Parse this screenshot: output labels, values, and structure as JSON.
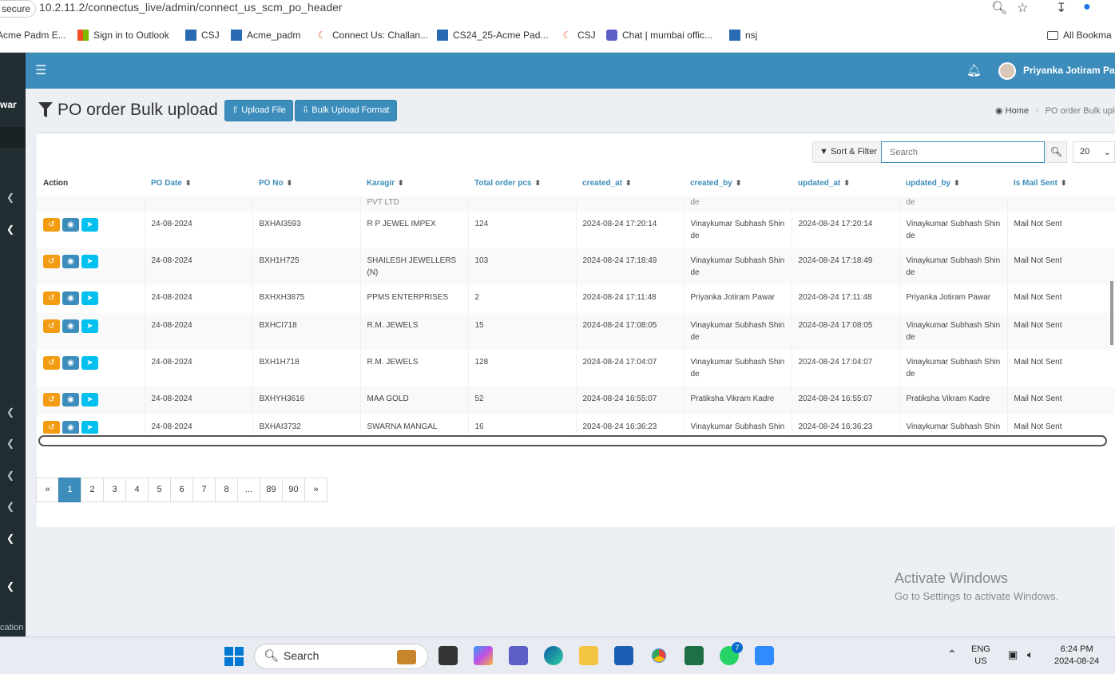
{
  "browser": {
    "secure_label": "secure",
    "url": "10.2.11.2/connectus_live/admin/connect_us_scm_po_header"
  },
  "bookmarks": [
    {
      "label": "Acme Padm E...",
      "icon": "favicon-icon"
    },
    {
      "label": "Sign in to Outlook",
      "icon": "microsoft-icon"
    },
    {
      "label": "CSJ",
      "icon": "app-icon"
    },
    {
      "label": "Acme_padm",
      "icon": "app-icon"
    },
    {
      "label": "Connect Us: Challan...",
      "icon": "connectus-icon"
    },
    {
      "label": "CS24_25-Acme Pad...",
      "icon": "app-icon"
    },
    {
      "label": "CSJ",
      "icon": "connectus-icon"
    },
    {
      "label": "Chat | mumbai offic...",
      "icon": "teams-icon"
    },
    {
      "label": "nsj",
      "icon": "app-icon"
    },
    {
      "label": "All Bookma",
      "icon": "folder-icon"
    }
  ],
  "sidebar": {
    "user_fragment": "war",
    "bottom_fragment": "cation"
  },
  "topnav": {
    "user_name": "Priyanka Jotiram Paw"
  },
  "page": {
    "title": "PO order Bulk upload",
    "upload_button": "Upload File",
    "format_button": "Bulk Upload Format",
    "breadcrumb_home": "Home",
    "breadcrumb_sep": ">",
    "breadcrumb_current": "PO order Bulk uploa"
  },
  "tools": {
    "sort_filter": "Sort & Filter",
    "search_placeholder": "Search",
    "page_size": "20"
  },
  "table": {
    "headers": [
      "Action",
      "PO Date",
      "PO No",
      "Karagir",
      "Total order pcs",
      "created_at",
      "created_by",
      "updated_at",
      "updated_by",
      "Is Mail Sent"
    ],
    "partial_row": {
      "karagir": "PVT LTD",
      "created_by": "de",
      "updated_by": "de"
    },
    "rows": [
      {
        "po_date": "24-08-2024",
        "po_no": "BXHAI3593",
        "karagir": "R P JEWEL IMPEX",
        "pcs": "124",
        "created_at": "2024-08-24 17:20:14",
        "created_by": "Vinaykumar Subhash Shin de",
        "updated_at": "2024-08-24 17:20:14",
        "updated_by": "Vinaykumar Subhash Shin de",
        "mail": "Mail Not Sent"
      },
      {
        "po_date": "24-08-2024",
        "po_no": "BXH1H725",
        "karagir": "SHAILESH JEWELLERS (N)",
        "pcs": "103",
        "created_at": "2024-08-24 17:18:49",
        "created_by": "Vinaykumar Subhash Shin de",
        "updated_at": "2024-08-24 17:18:49",
        "updated_by": "Vinaykumar Subhash Shin de",
        "mail": "Mail Not Sent"
      },
      {
        "po_date": "24-08-2024",
        "po_no": "BXHXH3875",
        "karagir": "PPMS ENTERPRISES",
        "pcs": "2",
        "created_at": "2024-08-24 17:11:48",
        "created_by": "Priyanka Jotiram Pawar",
        "updated_at": "2024-08-24 17:11:48",
        "updated_by": "Priyanka Jotiram Pawar",
        "mail": "Mail Not Sent"
      },
      {
        "po_date": "24-08-2024",
        "po_no": "BXHCI718",
        "karagir": "R.M. JEWELS",
        "pcs": "15",
        "created_at": "2024-08-24 17:08:05",
        "created_by": "Vinaykumar Subhash Shin de",
        "updated_at": "2024-08-24 17:08:05",
        "updated_by": "Vinaykumar Subhash Shin de",
        "mail": "Mail Not Sent"
      },
      {
        "po_date": "24-08-2024",
        "po_no": "BXH1H718",
        "karagir": "R.M. JEWELS",
        "pcs": "128",
        "created_at": "2024-08-24 17:04:07",
        "created_by": "Vinaykumar Subhash Shin de",
        "updated_at": "2024-08-24 17:04:07",
        "updated_by": "Vinaykumar Subhash Shin de",
        "mail": "Mail Not Sent"
      },
      {
        "po_date": "24-08-2024",
        "po_no": "BXHYH3616",
        "karagir": "MAA GOLD",
        "pcs": "52",
        "created_at": "2024-08-24 16:55:07",
        "created_by": "Pratiksha Vikram Kadre",
        "updated_at": "2024-08-24 16:55:07",
        "updated_by": "Pratiksha Vikram Kadre",
        "mail": "Mail Not Sent"
      },
      {
        "po_date": "24-08-2024",
        "po_no": "BXHAI3732",
        "karagir": "SWARNA MANGAL JEWELL",
        "pcs": "16",
        "created_at": "2024-08-24 16:36:23",
        "created_by": "Vinaykumar Subhash Shin",
        "updated_at": "2024-08-24 16:36:23",
        "updated_by": "Vinaykumar Subhash Shin",
        "mail": "Mail Not Sent"
      }
    ]
  },
  "pagination": [
    "«",
    "1",
    "2",
    "3",
    "4",
    "5",
    "6",
    "7",
    "8",
    "...",
    "89",
    "90",
    "»"
  ],
  "watermark": {
    "line1": "Activate Windows",
    "line2": "Go to Settings to activate Windows."
  },
  "taskbar": {
    "search": "Search",
    "lang1": "ENG",
    "lang2": "US",
    "time": "6:24 PM",
    "date": "2024-08-24",
    "whatsapp_badge": "7"
  },
  "colors": {
    "primary": "#3c8dbc",
    "sidebar": "#222d32",
    "orange": "#f39c12",
    "aqua": "#00c0ef"
  }
}
